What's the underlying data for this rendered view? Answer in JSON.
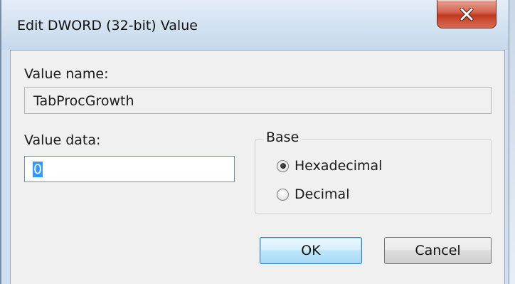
{
  "dialog": {
    "title": "Edit DWORD (32-bit) Value",
    "value_name_label": "Value name:",
    "value_name": "TabProcGrowth",
    "value_data_label": "Value data:",
    "value_data": "0",
    "base": {
      "label": "Base",
      "options": [
        {
          "label": "Hexadecimal",
          "selected": true
        },
        {
          "label": "Decimal",
          "selected": false
        }
      ]
    },
    "ok_label": "OK",
    "cancel_label": "Cancel"
  },
  "icons": {
    "close": "close-icon"
  },
  "colors": {
    "titlebar": "#d3e2f1",
    "client": "#f0f0f0",
    "close_button": "#c0391f",
    "selection": "#3399ff",
    "default_button_border": "#3c7fb1"
  }
}
